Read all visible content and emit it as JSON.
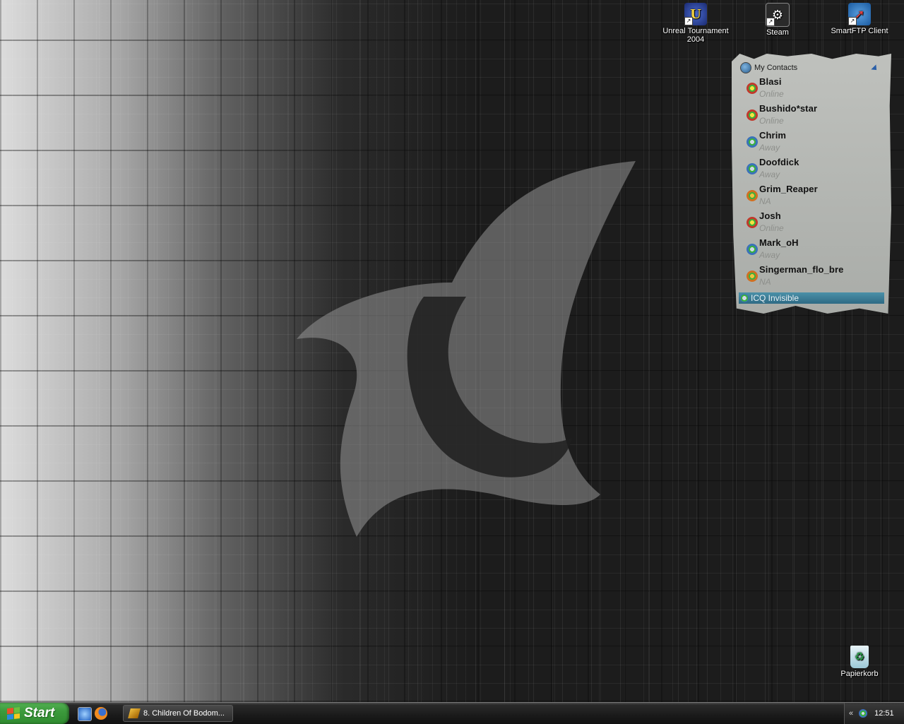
{
  "desktop": {
    "icons": [
      {
        "label": "Unreal Tournament 2004",
        "icon": "unreal-tournament-icon"
      },
      {
        "label": "Steam",
        "icon": "steam-icon"
      },
      {
        "label": "SmartFTP Client",
        "icon": "smartftp-icon"
      },
      {
        "label": "Papierkorb",
        "icon": "recycle-bin-icon"
      }
    ]
  },
  "icq": {
    "group_label": "My Contacts",
    "contacts": [
      {
        "name": "Blasi",
        "status": "Online"
      },
      {
        "name": "Bushido*star",
        "status": "Online"
      },
      {
        "name": "Chrim",
        "status": "Away"
      },
      {
        "name": "Doofdick",
        "status": "Away"
      },
      {
        "name": "Grim_Reaper",
        "status": "NA"
      },
      {
        "name": "Josh",
        "status": "Online"
      },
      {
        "name": "Mark_oH",
        "status": "Away"
      },
      {
        "name": "Singerman_flo_bre",
        "status": "NA"
      }
    ],
    "own_status": "ICQ Invisible"
  },
  "taskbar": {
    "start_label": "Start",
    "quicklaunch": [
      "internet-explorer-icon",
      "firefox-icon"
    ],
    "task": {
      "label": "8. Children Of Bodom...",
      "icon": "winamp-icon"
    },
    "tray": {
      "chevron": "«",
      "clock": "12:51"
    }
  },
  "colors": {
    "taskbar": "#1a1a1a",
    "start_green": "#3c9a3c",
    "icq_panel": "#bfc1bd",
    "icq_status_bar": "#3a7c96"
  }
}
